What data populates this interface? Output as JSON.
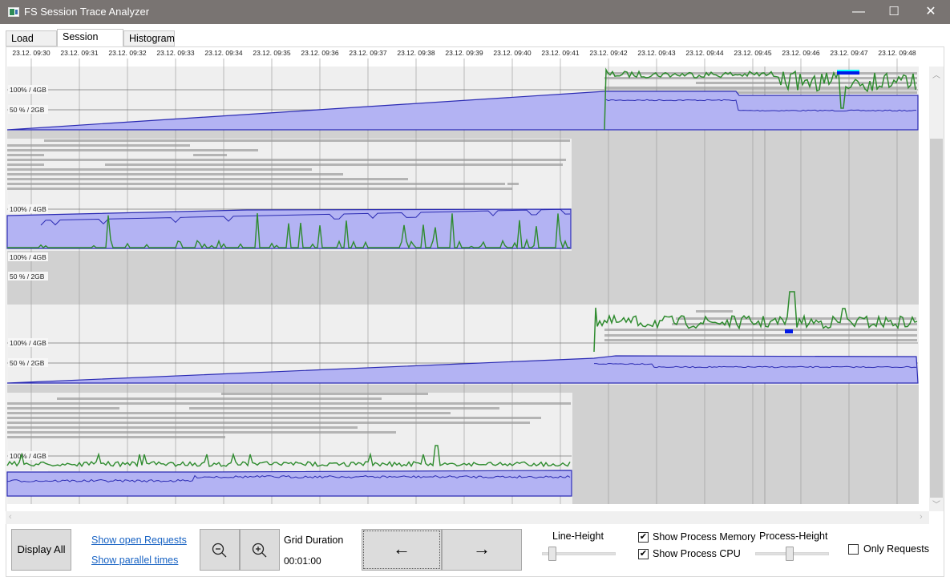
{
  "window": {
    "title": "FS Session Trace Analyzer",
    "minimize_glyph": "—",
    "maximize_glyph": "☐",
    "close_glyph": "✕"
  },
  "tabs": [
    {
      "label": "Load Files",
      "active": false
    },
    {
      "label": "Session Map",
      "active": true
    },
    {
      "label": "Histogram",
      "active": false
    }
  ],
  "timeline": {
    "time_labels": [
      "23.12. 09:30",
      "23.12. 09:31",
      "23.12. 09:32",
      "23.12. 09:33",
      "23.12. 09:34",
      "23.12. 09:35",
      "23.12. 09:36",
      "23.12. 09:37",
      "23.12. 09:38",
      "23.12. 09:39",
      "23.12. 09:40",
      "23.12. 09:41",
      "23.12. 09:42",
      "23.12. 09:43",
      "23.12. 09:44",
      "23.12. 09:45",
      "23.12. 09:46",
      "23.12. 09:47",
      "23.12. 09:48"
    ],
    "axis_labels": {
      "full": "100% / 4GB",
      "half": "50 % / 2GB"
    },
    "colors": {
      "memory_fill": "#b3b3f3",
      "memory_line": "#2b2bb3",
      "cpu_line": "#2e8b2e",
      "request_bar": "#b4b4b4",
      "session_bg": "#efefef",
      "empty_bg": "#d1d1d1",
      "highlight_bar": "#0018e6"
    }
  },
  "controls": {
    "display_all": "Display All",
    "show_open_requests": "Show open Requests",
    "show_parallel_times": "Show parallel times",
    "zoom_out_icon": "zoom-out-icon",
    "zoom_in_icon": "zoom-in-icon",
    "grid_duration_label": "Grid Duration",
    "grid_duration_value": "00:01:00",
    "prev_glyph": "←",
    "next_glyph": "→",
    "line_height_label": "Line-Height",
    "line_height_value": 0.1,
    "show_process_memory": {
      "label": "Show Process Memory",
      "checked": true
    },
    "show_process_cpu": {
      "label": "Show Process CPU",
      "checked": true
    },
    "process_height_label": "Process-Height",
    "process_height_value": 0.5,
    "only_requests": {
      "label": "Only Requests",
      "checked": false
    },
    "check_glyph": "✔"
  }
}
